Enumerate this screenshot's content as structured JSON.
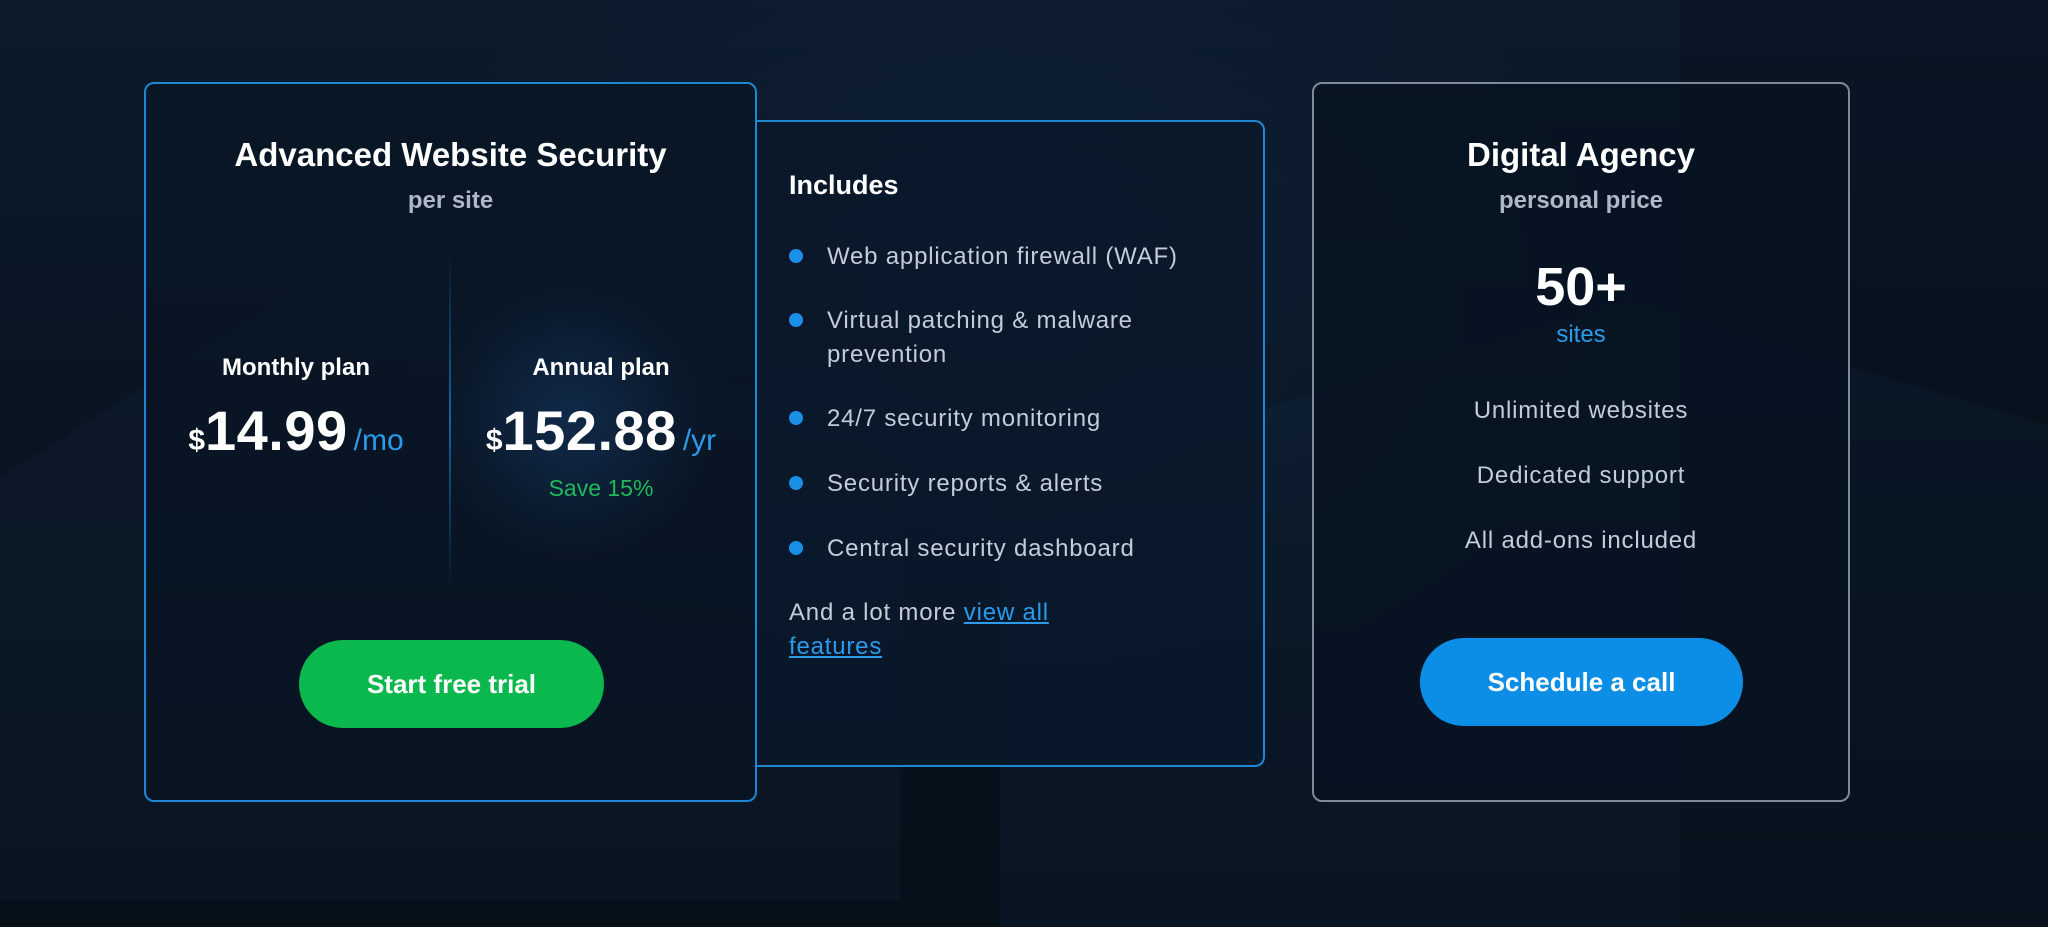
{
  "main_card": {
    "title": "Advanced Website Security",
    "subtitle": "per site",
    "monthly": {
      "label": "Monthly plan",
      "currency": "$",
      "amount": "14.99",
      "period": "/mo"
    },
    "annual": {
      "label": "Annual plan",
      "currency": "$",
      "amount": "152.88",
      "period": "/yr",
      "save": "Save 15%"
    },
    "cta_label": "Start free trial"
  },
  "includes": {
    "title": "Includes",
    "items": [
      "Web application firewall (WAF)",
      "Virtual patching & malware prevention",
      "24/7 security monitoring",
      "Security reports & alerts",
      "Central security dashboard"
    ],
    "more_text": "And a lot more",
    "more_link": "view all features"
  },
  "agency_card": {
    "title": "Digital Agency",
    "subtitle": "personal price",
    "count": "50+",
    "count_unit": "sites",
    "features": [
      "Unlimited websites",
      "Dedicated support",
      "All add-ons included"
    ],
    "cta_label": "Schedule a call"
  },
  "colors": {
    "accent_blue": "#1f86d4",
    "trial_green": "#0ab84d",
    "save_green": "#1fb95a",
    "call_blue": "#0d8ee6",
    "background": "#0a1626"
  }
}
